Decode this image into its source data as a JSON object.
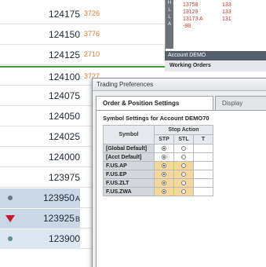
{
  "ladder": [
    {
      "price": "124175",
      "volume": "3726",
      "marker": "",
      "style": "light"
    },
    {
      "price": "124150",
      "volume": "3776",
      "marker": "",
      "style": "light"
    },
    {
      "price": "124125",
      "volume": "2710",
      "marker": "",
      "style": "light"
    },
    {
      "price": "124100",
      "volume": "3727",
      "marker": "",
      "style": "green"
    },
    {
      "price": "124075",
      "volume": "",
      "marker": "",
      "style": "light"
    },
    {
      "price": "124050",
      "volume": "",
      "marker": "",
      "style": "light"
    },
    {
      "price": "124025",
      "volume": "",
      "marker": "",
      "style": "light"
    },
    {
      "price": "124000",
      "volume": "",
      "marker": "",
      "style": "light"
    },
    {
      "price": "123975",
      "volume": "",
      "marker": "",
      "style": "light"
    },
    {
      "price": "123950",
      "suffix": "A",
      "volume": "",
      "marker": "dot",
      "style": "blue"
    },
    {
      "price": "123925",
      "suffix": "B",
      "volume": "",
      "marker": "triangle",
      "style": "blue"
    },
    {
      "price": "123900",
      "volume": "",
      "marker": "dot",
      "style": "blue2"
    }
  ],
  "mini_panel": {
    "side_labels": [
      "H",
      "L",
      "L",
      "A"
    ],
    "col1": [
      "13758",
      "13129",
      "13173 A",
      "-98"
    ],
    "col2": [
      "133",
      "133",
      "131",
      ""
    ]
  },
  "account_bar": "Account DEMO",
  "working_orders": "Working Orders",
  "dialog": {
    "title": "Trading Preferences",
    "tabs": [
      "Order & Position Settings",
      "Display"
    ],
    "section_title": "Symbol Settings for Account DEMO70",
    "table": {
      "symbol_header": "Symbol",
      "group_header": "Stop Action",
      "col_headers": [
        "STP",
        "STL",
        "T"
      ],
      "rows": [
        {
          "symbol": "[Global Default]",
          "stp": true,
          "stl": false
        },
        {
          "symbol": "[Acct Default]",
          "stp": true,
          "stl": false
        },
        {
          "symbol": "F.US.AP",
          "stp": true,
          "stl": false
        },
        {
          "symbol": "F.US.EP",
          "stp": true,
          "stl": false
        },
        {
          "symbol": "F.US.ZLT",
          "stp": true,
          "stl": false
        },
        {
          "symbol": "F.US.ZWA",
          "stp": true,
          "stl": false
        }
      ]
    }
  },
  "colors": {
    "sell_triangle": "#c8162a",
    "green_line": "#3e9a3e",
    "highlight_orange": "#f6d79a"
  }
}
